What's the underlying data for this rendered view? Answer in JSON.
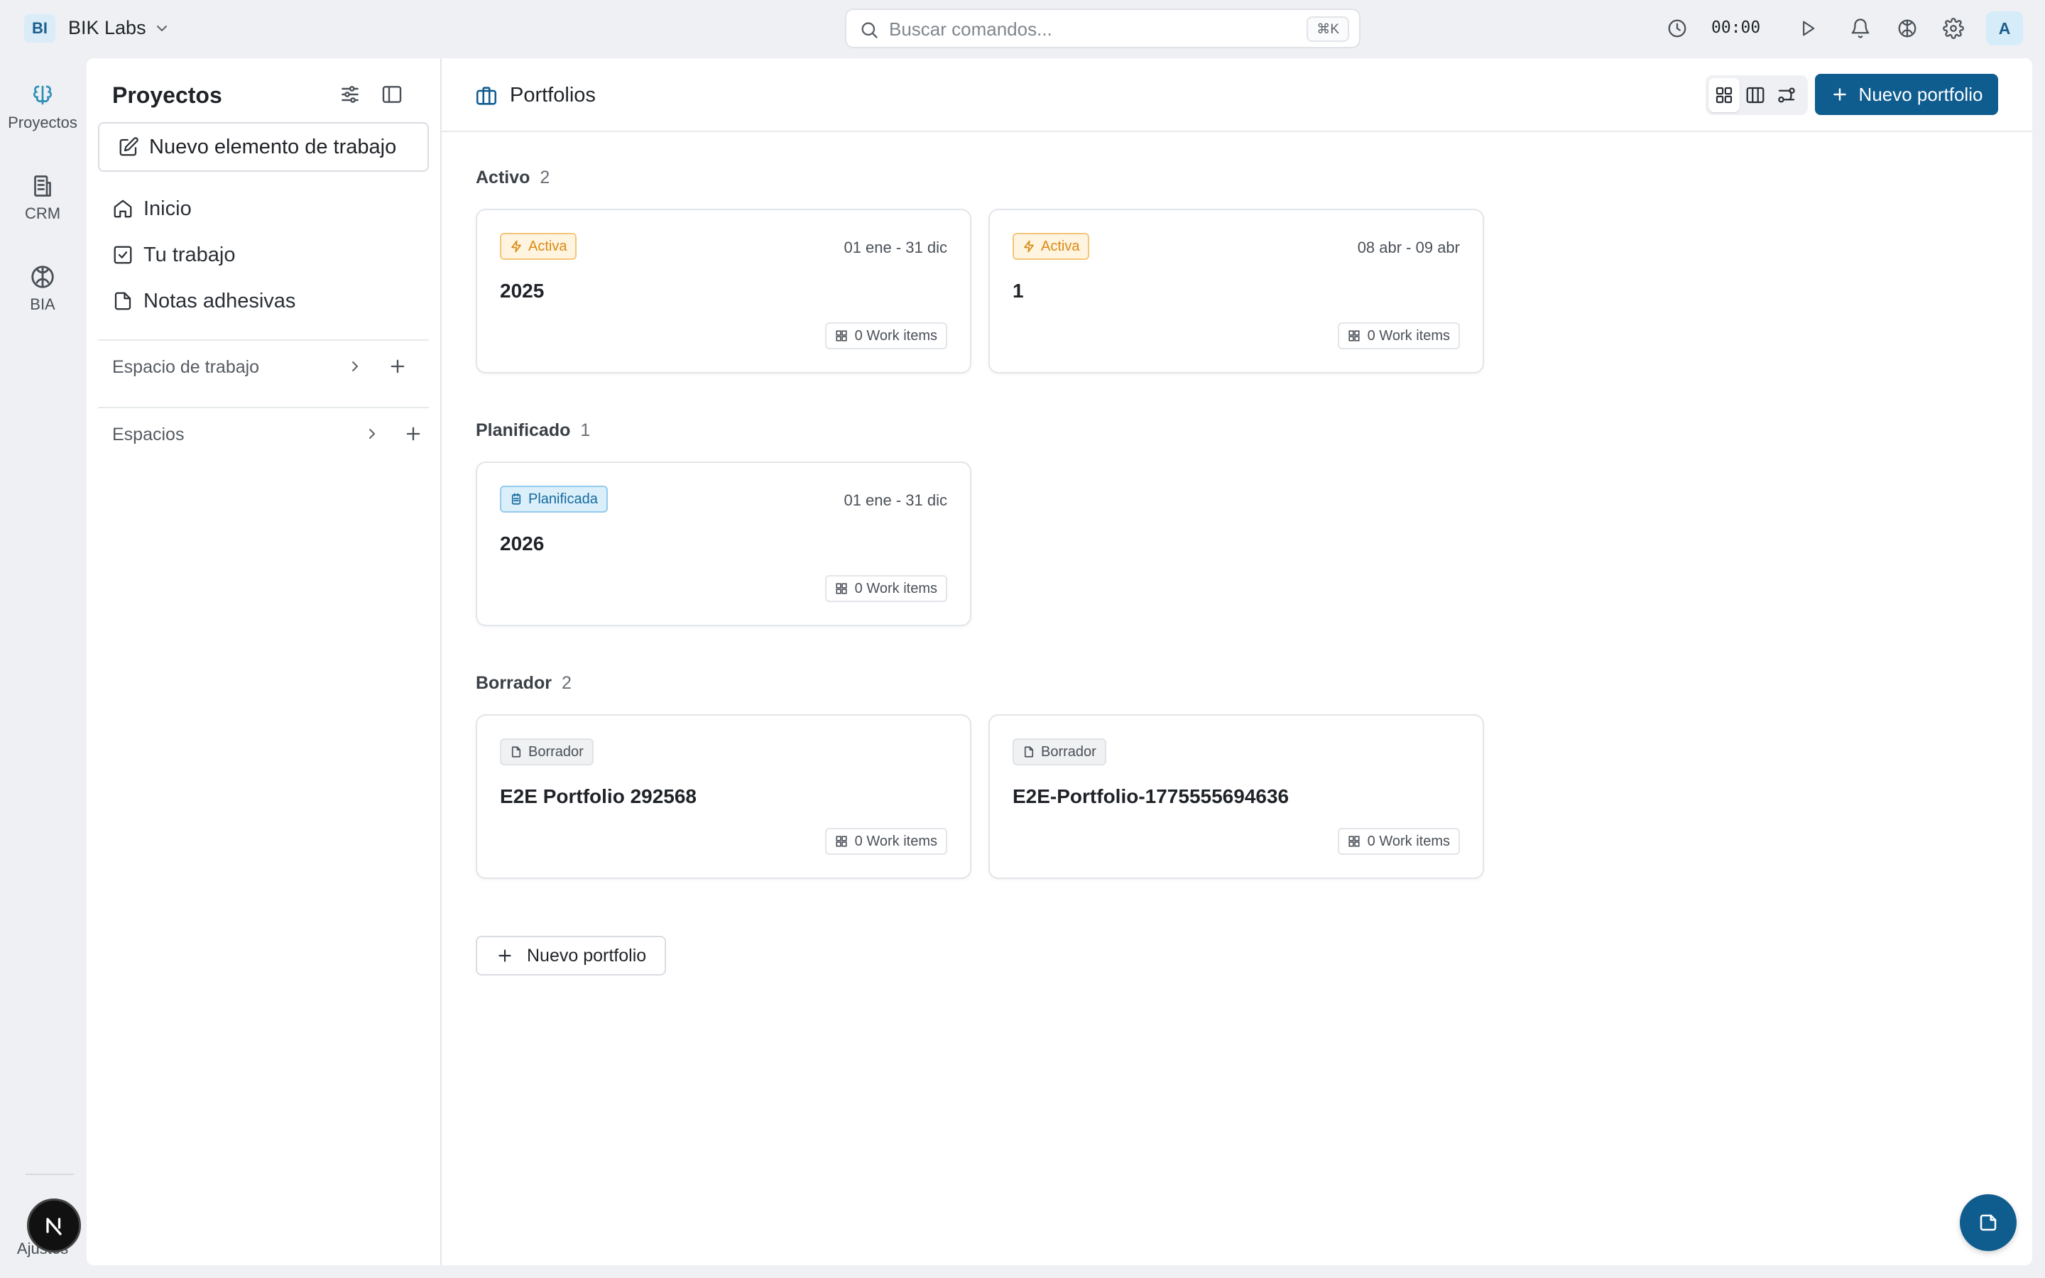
{
  "workspace": {
    "badge": "BI",
    "name": "BIK Labs"
  },
  "search": {
    "placeholder": "Buscar comandos...",
    "shortcut": "⌘K"
  },
  "timer": {
    "value": "00:00"
  },
  "user": {
    "avatar_initial": "A"
  },
  "rail": {
    "items": [
      {
        "label": "Proyectos",
        "icon": "projects-icon"
      },
      {
        "label": "CRM",
        "icon": "crm-icon"
      },
      {
        "label": "BIA",
        "icon": "brain-icon"
      }
    ],
    "settings_label": "Ajustes",
    "badge_letter": "N"
  },
  "sidebar": {
    "title": "Proyectos",
    "new_item_label": "Nuevo elemento de trabajo",
    "nav": [
      {
        "label": "Inicio",
        "icon": "home-icon"
      },
      {
        "label": "Tu trabajo",
        "icon": "check-square-icon"
      },
      {
        "label": "Notas adhesivas",
        "icon": "note-icon"
      }
    ],
    "sections": [
      {
        "label": "Espacio de trabajo"
      },
      {
        "label": "Espacios"
      }
    ]
  },
  "main": {
    "title": "Portfolios",
    "new_portfolio_label": "Nuevo portfolio",
    "add_portfolio_label": "Nuevo portfolio",
    "groups": [
      {
        "label": "Activo",
        "count": "2",
        "cards": [
          {
            "badge": "Activa",
            "date": "01 ene - 31 dic",
            "title": "2025",
            "work_items": "0 Work items"
          },
          {
            "badge": "Activa",
            "date": "08 abr - 09 abr",
            "title": "1",
            "work_items": "0 Work items"
          }
        ]
      },
      {
        "label": "Planificado",
        "count": "1",
        "cards": [
          {
            "badge": "Planificada",
            "date": "01 ene - 31 dic",
            "title": "2026",
            "work_items": "0 Work items"
          }
        ]
      },
      {
        "label": "Borrador",
        "count": "2",
        "cards": [
          {
            "badge": "Borrador",
            "date": "",
            "title": "E2E Portfolio 292568",
            "work_items": "0 Work items"
          },
          {
            "badge": "Borrador",
            "date": "",
            "title": "E2E-Portfolio-1775555694636",
            "work_items": "0 Work items"
          }
        ]
      }
    ]
  },
  "colors": {
    "primary": "#0f5c8f",
    "active_badge": "#d88a12",
    "planned_badge": "#156a9c",
    "background": "#eef0f3"
  }
}
